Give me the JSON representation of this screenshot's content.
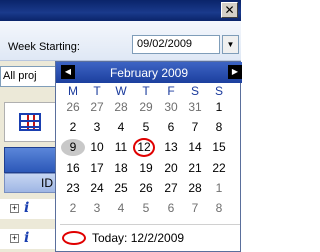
{
  "window": {
    "close_label": "✕"
  },
  "toolbar": {
    "week_label": "Week Starting:",
    "week_value": "09/02/2009",
    "dropdown_arrow": "▼",
    "project_filter_value": "All proj"
  },
  "grid": {
    "id_header": "ID",
    "rows": [
      {
        "expander": "+",
        "icon": "i"
      },
      {
        "expander": "+",
        "icon": "i"
      }
    ]
  },
  "calendar": {
    "month_title": "February 2009",
    "prev_glyph": "◀",
    "next_glyph": "▶",
    "weekdays": [
      "M",
      "T",
      "W",
      "T",
      "F",
      "S",
      "S"
    ],
    "weeks": [
      [
        "26",
        "27",
        "28",
        "29",
        "30",
        "31",
        "1"
      ],
      [
        "2",
        "3",
        "4",
        "5",
        "6",
        "7",
        "8"
      ],
      [
        "9",
        "10",
        "11",
        "12",
        "13",
        "14",
        "15"
      ],
      [
        "16",
        "17",
        "18",
        "19",
        "20",
        "21",
        "22"
      ],
      [
        "23",
        "24",
        "25",
        "26",
        "27",
        "28",
        "1"
      ],
      [
        "2",
        "3",
        "4",
        "5",
        "6",
        "7",
        "8"
      ]
    ],
    "selected_day": "9",
    "today_day": "12",
    "today_label": "Today: 12/2/2009"
  },
  "colors": {
    "header_blue": "#1c3f9e",
    "today_ring": "#e00000",
    "weekday_blue": "#1a3a9c"
  }
}
